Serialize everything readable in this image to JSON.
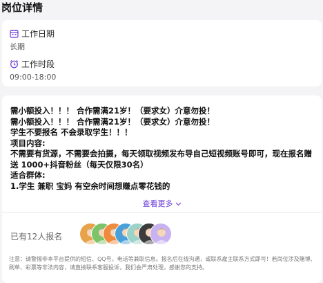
{
  "page": {
    "section_title": "岗位详情"
  },
  "schedule": {
    "work_date_label": "工作日期",
    "work_date_value": "长期",
    "work_time_label": "工作时段",
    "work_time_value": "09:00-18:00",
    "icons": {
      "date": "calendar-icon",
      "time": "alarm-clock-icon"
    }
  },
  "detail": {
    "lines": [
      "需小额投入！！！ 合作需满21岁！（要求女）介意勿投！",
      "需小额投入！！！ 合作需满21岁！（要求女）介意勿投！",
      "学生不要报名 不会录取学生！！！",
      "项目内容:",
      "不需要有货源，不需要会拍摄，每天领取视频发布导自己短视频账号即可，现在报名赠送 1000+抖音粉丝（每天仅限30名）",
      "适合群体:",
      "1.学生 兼职 宝妈 有空余时间想赚点零花钱的"
    ],
    "more_label": "查看更多",
    "applied_text": "已有12人报名",
    "avatars": [
      {
        "icon": "avatar-icon",
        "color": "#e8a24a"
      },
      {
        "icon": "avatar-icon",
        "color": "#7cc36a"
      },
      {
        "icon": "avatar-icon",
        "color": "#f08a3c"
      },
      {
        "icon": "avatar-icon",
        "color": "#4aa0d8"
      },
      {
        "icon": "avatar-icon",
        "color": "#9cd3c8"
      },
      {
        "icon": "avatar-icon",
        "color": "#3c3c3c"
      },
      {
        "icon": "avatar-icon",
        "color": "#c9b2f0"
      }
    ],
    "notice": "注意：请警惕非本平台提供的短信、QQ号，电话等兼职信息。报名后在线沟通，或联系雇主联系方式即可！若岗位涉及赌博、刷单、彩票等非法内容，请直接联系客服投诉，我们会严肃处理，感谢您的支持。",
    "colors": {
      "accent": "#6a3bd8"
    }
  }
}
